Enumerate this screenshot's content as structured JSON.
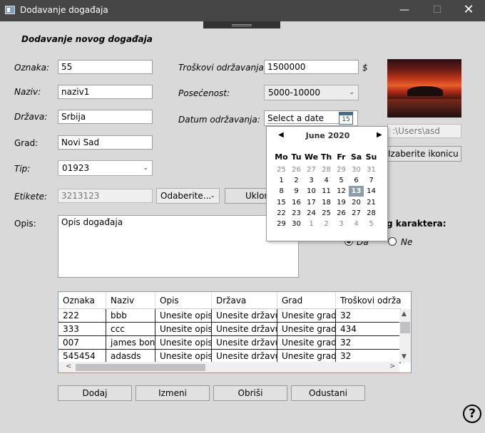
{
  "window": {
    "title": "Dodavanje događaja",
    "min": "—",
    "max": "☐",
    "close": "✕"
  },
  "heading": "Dodavanje novog događaja",
  "labels": {
    "oznaka": "Oznaka:",
    "naziv": "Naziv:",
    "drzava": "Država:",
    "grad": "Grad:",
    "tip": "Tip:",
    "etikete": "Etikete:",
    "opis": "Opis:",
    "troskovi": "Troškovi održavanja:",
    "posecenost": "Posećenost:",
    "datum": "Datum održavanja:",
    "currency": "$",
    "humanitarni_suffix": "g karaktera:",
    "da": "Da",
    "ne": "Ne"
  },
  "fields": {
    "oznaka": "55",
    "naziv": "naziv1",
    "drzava": "Srbija",
    "grad": "Novi Sad",
    "tip": "01923",
    "etikete": "3213123",
    "etikete_select": "Odaberite...",
    "ukloni": "Uklon",
    "opis": "Opis događaja",
    "troskovi": "1500000",
    "posecenost": "5000-10000",
    "datum_placeholder": "Select a date",
    "icon_path": "C:\\Users\\asd",
    "icon_path_visible": ":\\Users\\asd",
    "izaberite_ikonicu": "Izaberite ikonicu",
    "humanitarni": "Ne"
  },
  "calendar": {
    "month": "June 2020",
    "days_of_week": [
      "Mo",
      "Tu",
      "We",
      "Th",
      "Fr",
      "Sa",
      "Su"
    ],
    "weeks": [
      [
        "25",
        "26",
        "27",
        "28",
        "29",
        "30",
        "31"
      ],
      [
        "1",
        "2",
        "3",
        "4",
        "5",
        "6",
        "7"
      ],
      [
        "8",
        "9",
        "10",
        "11",
        "12",
        "13",
        "14"
      ],
      [
        "15",
        "16",
        "17",
        "18",
        "19",
        "20",
        "21"
      ],
      [
        "22",
        "23",
        "24",
        "25",
        "26",
        "27",
        "28"
      ],
      [
        "29",
        "30",
        "1",
        "2",
        "3",
        "4",
        "5"
      ]
    ],
    "selected": "13",
    "icon_day": "15"
  },
  "table": {
    "columns": [
      "Oznaka",
      "Naziv",
      "Opis",
      "Država",
      "Grad",
      "Troškovi održa"
    ],
    "rows": [
      [
        "222",
        "bbb",
        "Unesite opis...",
        "Unesite državu...",
        "Unesite grad...",
        "32"
      ],
      [
        "333",
        "ccc",
        "Unesite opis...",
        "Unesite državu...",
        "Unesite grad...",
        "434"
      ],
      [
        "007",
        "james bond",
        "Unesite opis...",
        "Unesite državu...",
        "Unesite grad...",
        "32"
      ],
      [
        "545454",
        "adasds",
        "Unesite opis...",
        "Unesite državu...",
        "Unesite grad...",
        "32"
      ]
    ]
  },
  "buttons": {
    "dodaj": "Dodaj",
    "izmeni": "Izmeni",
    "obrisi": "Obriši",
    "odustani": "Odustani",
    "help": "?"
  }
}
